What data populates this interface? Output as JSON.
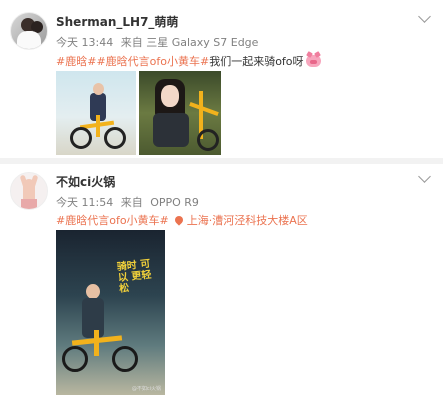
{
  "posts": [
    {
      "username": "Sherman_LH7_萌萌",
      "time": "今天 13:44",
      "source_prefix": "来自",
      "device": "三星 Galaxy S7 Edge",
      "topics": [
        "#鹿晗#",
        "#鹿晗代言ofo小黄车#"
      ],
      "text": "我们一起来骑ofo呀",
      "emoji": "pig-emoji",
      "images": 2
    },
    {
      "username": "不如ci火锅",
      "time": "今天 11:54",
      "source_prefix": "来自",
      "device": "OPPO R9",
      "topics": [
        "#鹿晗代言ofo小黄车#"
      ],
      "location": "上海·漕河泾科技大楼A区",
      "images": 1,
      "poster_text": "骑时 可以 更轻松",
      "watermark": "@不如ci火锅"
    }
  ],
  "colors": {
    "accent": "#eb7350",
    "muted": "#808080",
    "ofo_yellow": "#f2b21c"
  }
}
